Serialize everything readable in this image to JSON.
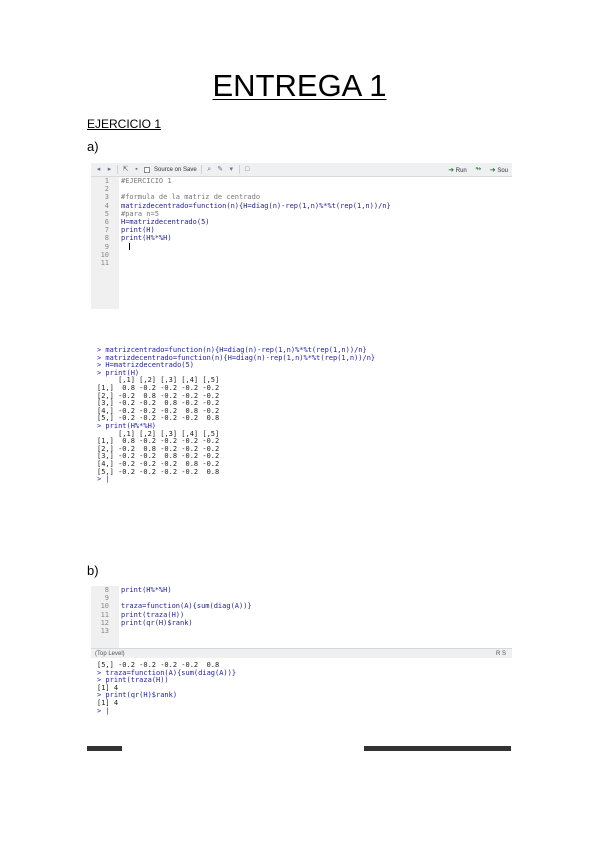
{
  "document": {
    "title": "ENTREGA 1",
    "section": "EJERCICIO 1",
    "part_a": "a)",
    "part_b": "b)"
  },
  "editor_a": {
    "toolbar": {
      "source_on_save": "Source on Save",
      "run_label": "Run",
      "source_label": "Sou"
    },
    "lines": [
      {
        "n": "1",
        "text": "#EJERCICIO 1",
        "kind": "comment"
      },
      {
        "n": "2",
        "text": "",
        "kind": "code"
      },
      {
        "n": "3",
        "text": "#formula de la matriz de centrado",
        "kind": "comment"
      },
      {
        "n": "4",
        "text": "matrizdecentrado=function(n){H=diag(n)-rep(1,n)%*%t(rep(1,n))/n}",
        "kind": "code"
      },
      {
        "n": "5",
        "text": "#para n=5",
        "kind": "comment"
      },
      {
        "n": "6",
        "text": "H=matrizdecentrado(5)",
        "kind": "code"
      },
      {
        "n": "7",
        "text": "print(H)",
        "kind": "code"
      },
      {
        "n": "8",
        "text": "print(H%*%H)",
        "kind": "code"
      },
      {
        "n": "9",
        "text": "",
        "kind": "code"
      },
      {
        "n": "10",
        "text": "",
        "kind": "code"
      },
      {
        "n": "11",
        "text": "",
        "kind": "code"
      }
    ]
  },
  "console_a": {
    "lines": [
      {
        "text": "> matrizcentrado=function(n){H=diag(n)-rep(1,n)%*%t(rep(1,n))/n}",
        "kind": "cmd"
      },
      {
        "text": "> matrizdecentrado=function(n){H=diag(n)-rep(1,n)%*%t(rep(1,n))/n}",
        "kind": "cmd"
      },
      {
        "text": "> H=matrizdecentrado(5)",
        "kind": "cmd"
      },
      {
        "text": "> print(H)",
        "kind": "cmd"
      },
      {
        "text": "     [,1] [,2] [,3] [,4] [,5]",
        "kind": "out"
      },
      {
        "text": "[1,]  0.8 -0.2 -0.2 -0.2 -0.2",
        "kind": "out"
      },
      {
        "text": "[2,] -0.2  0.8 -0.2 -0.2 -0.2",
        "kind": "out"
      },
      {
        "text": "[3,] -0.2 -0.2  0.8 -0.2 -0.2",
        "kind": "out"
      },
      {
        "text": "[4,] -0.2 -0.2 -0.2  0.8 -0.2",
        "kind": "out"
      },
      {
        "text": "[5,] -0.2 -0.2 -0.2 -0.2  0.8",
        "kind": "out"
      },
      {
        "text": "> print(H%*%H)",
        "kind": "cmd"
      },
      {
        "text": "     [,1] [,2] [,3] [,4] [,5]",
        "kind": "out"
      },
      {
        "text": "[1,]  0.8 -0.2 -0.2 -0.2 -0.2",
        "kind": "out"
      },
      {
        "text": "[2,] -0.2  0.8 -0.2 -0.2 -0.2",
        "kind": "out"
      },
      {
        "text": "[3,] -0.2 -0.2  0.8 -0.2 -0.2",
        "kind": "out"
      },
      {
        "text": "[4,] -0.2 -0.2 -0.2  0.8 -0.2",
        "kind": "out"
      },
      {
        "text": "[5,] -0.2 -0.2 -0.2 -0.2  0.8",
        "kind": "out"
      },
      {
        "text": "> |",
        "kind": "cmd"
      }
    ]
  },
  "editor_b": {
    "lines": [
      {
        "n": "8",
        "text": "print(H%*%H)",
        "kind": "code"
      },
      {
        "n": "9",
        "text": "",
        "kind": "code"
      },
      {
        "n": "10",
        "text": "traza=function(A){sum(diag(A))}",
        "kind": "code"
      },
      {
        "n": "11",
        "text": "print(traza(H))",
        "kind": "code"
      },
      {
        "n": "12",
        "text": "print(qr(H)$rank)",
        "kind": "code"
      },
      {
        "n": "13",
        "text": "",
        "kind": "code"
      }
    ],
    "status_left": "(Top Level)",
    "status_right": "R S"
  },
  "console_b": {
    "lines": [
      {
        "text": "[5,] -0.2 -0.2 -0.2 -0.2  0.8",
        "kind": "out"
      },
      {
        "text": "> traza=function(A){sum(diag(A))}",
        "kind": "cmd"
      },
      {
        "text": "> print(traza(H))",
        "kind": "cmd"
      },
      {
        "text": "[1] 4",
        "kind": "out"
      },
      {
        "text": "> print(qr(H)$rank)",
        "kind": "cmd"
      },
      {
        "text": "[1] 4",
        "kind": "out"
      },
      {
        "text": "> |",
        "kind": "cmd"
      }
    ]
  }
}
